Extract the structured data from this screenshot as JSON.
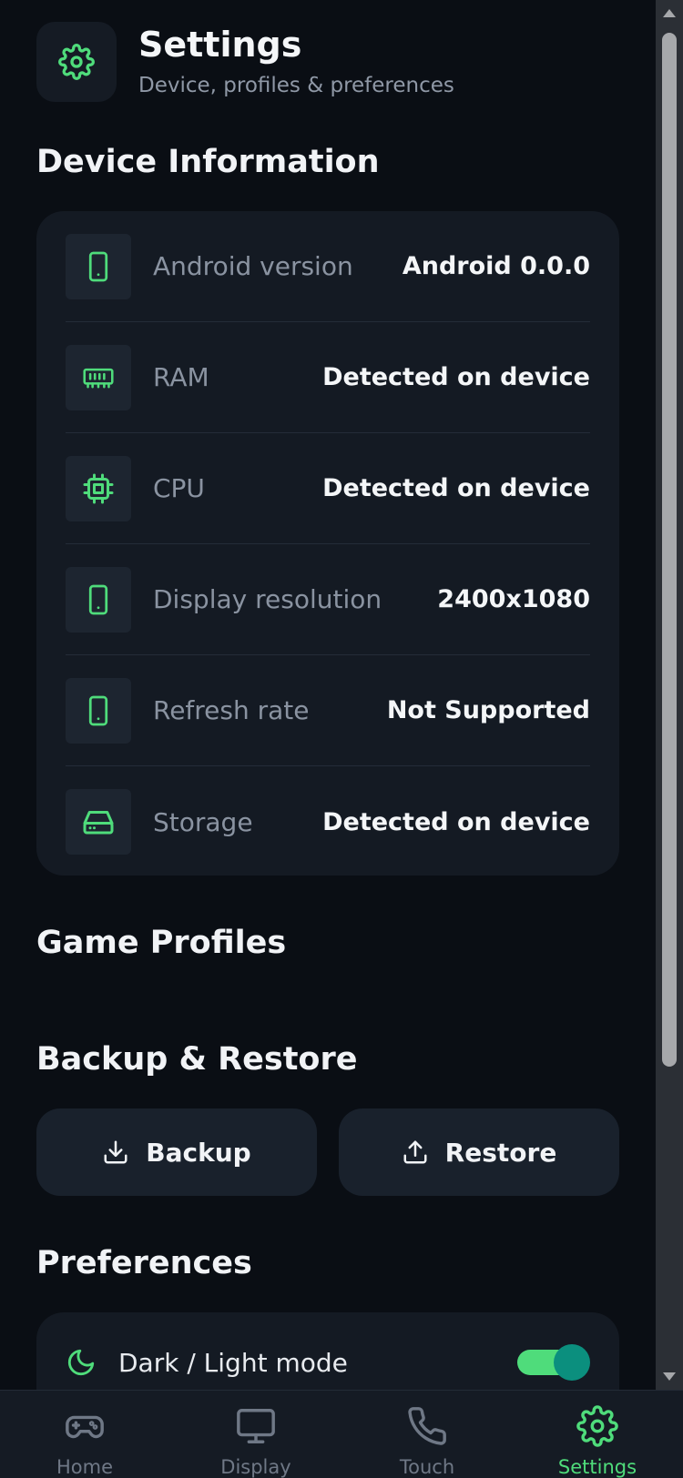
{
  "header": {
    "title": "Settings",
    "subtitle": "Device, profiles & preferences",
    "icon": "gear-icon"
  },
  "sections": {
    "device_information": "Device Information",
    "game_profiles": "Game Profiles",
    "backup_restore": "Backup & Restore",
    "preferences": "Preferences"
  },
  "device_info": [
    {
      "icon": "phone-icon",
      "label": "Android version",
      "value": "Android 0.0.0"
    },
    {
      "icon": "ram-icon",
      "label": "RAM",
      "value": "Detected on device"
    },
    {
      "icon": "cpu-icon",
      "label": "CPU",
      "value": "Detected on device"
    },
    {
      "icon": "phone-icon",
      "label": "Display resolution",
      "value": "2400x1080"
    },
    {
      "icon": "phone-icon",
      "label": "Refresh rate",
      "value": "Not Supported"
    },
    {
      "icon": "storage-icon",
      "label": "Storage",
      "value": "Detected on device"
    }
  ],
  "backup": {
    "backup_label": "Backup",
    "restore_label": "Restore"
  },
  "preferences": {
    "dark_mode_label": "Dark / Light mode",
    "dark_mode_enabled": true
  },
  "nav": {
    "items": [
      {
        "label": "Home",
        "icon": "gamepad-icon",
        "active": false
      },
      {
        "label": "Display",
        "icon": "monitor-icon",
        "active": false
      },
      {
        "label": "Touch",
        "icon": "phone-call-icon",
        "active": false
      },
      {
        "label": "Settings",
        "icon": "gear-icon",
        "active": true
      }
    ]
  },
  "colors": {
    "accent": "#4fdc7b",
    "background": "#0a0e14",
    "card": "#141a23",
    "toggle_knob": "#0b8f7e"
  }
}
